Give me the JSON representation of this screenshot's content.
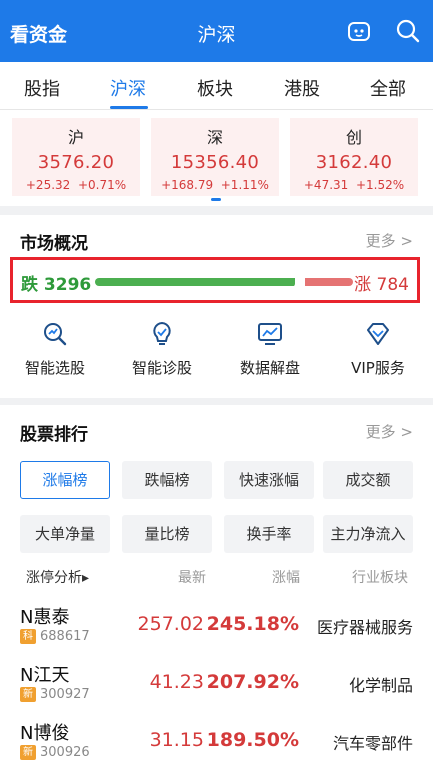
{
  "header": {
    "left_title": "看资金",
    "center_title": "沪深",
    "robot_icon": "robot-face-icon",
    "search_icon": "search-icon",
    "bg_color": "#1e7ae8"
  },
  "tabs": [
    {
      "label": "股指",
      "active": false
    },
    {
      "label": "沪深",
      "active": true
    },
    {
      "label": "板块",
      "active": false
    },
    {
      "label": "港股",
      "active": false
    },
    {
      "label": "全部",
      "active": false
    }
  ],
  "indices": [
    {
      "name": "沪",
      "value": "3576.20",
      "change": "+25.32",
      "pct": "+0.71%"
    },
    {
      "name": "深",
      "value": "15356.40",
      "change": "+168.79",
      "pct": "+1.11%"
    },
    {
      "name": "创",
      "value": "3162.40",
      "change": "+47.31",
      "pct": "+1.52%"
    }
  ],
  "market": {
    "title": "市场概况",
    "more": "更多 >",
    "fall_label": "跌 3296",
    "rise_label": "涨 784",
    "fall_count": 3296,
    "rise_count": 784,
    "fall_color": "#2e9a3a",
    "rise_color": "#d43a3a"
  },
  "tools": [
    {
      "label": "智能选股",
      "icon": "magnifier-chart-icon"
    },
    {
      "label": "智能诊股",
      "icon": "lightbulb-icon"
    },
    {
      "label": "数据解盘",
      "icon": "line-chart-screen-icon"
    },
    {
      "label": "VIP服务",
      "icon": "diamond-icon"
    }
  ],
  "ranking": {
    "title": "股票排行",
    "more": "更多 >",
    "chips_row1": [
      "涨幅榜",
      "跌幅榜",
      "快速涨幅",
      "成交额"
    ],
    "chips_row2": [
      "大单净量",
      "量比榜",
      "换手率",
      "主力净流入"
    ],
    "active_chip": "涨幅榜",
    "columns": [
      "涨停分析▸",
      "最新",
      "涨幅",
      "行业板块"
    ],
    "rows": [
      {
        "name": "N惠泰",
        "tag": "科",
        "code": "688617",
        "price": "257.02",
        "pct": "245.18%",
        "industry": "医疗器械服务"
      },
      {
        "name": "N江天",
        "tag": "新",
        "code": "300927",
        "price": "41.23",
        "pct": "207.92%",
        "industry": "化学制品"
      },
      {
        "name": "N博俊",
        "tag": "新",
        "code": "300926",
        "price": "31.15",
        "pct": "189.50%",
        "industry": "汽车零部件"
      }
    ]
  }
}
